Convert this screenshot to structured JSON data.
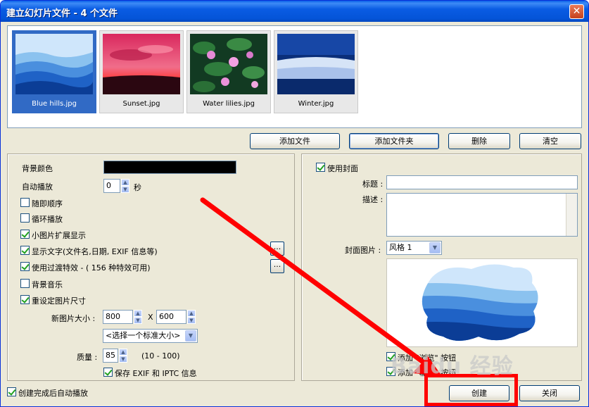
{
  "window": {
    "title": "建立幻灯片文件 - 4 个文件",
    "close_glyph": "✕"
  },
  "thumbnails": [
    {
      "caption": "Blue hills.jpg",
      "selected": true
    },
    {
      "caption": "Sunset.jpg",
      "selected": false
    },
    {
      "caption": "Water lilies.jpg",
      "selected": false
    },
    {
      "caption": "Winter.jpg",
      "selected": false
    }
  ],
  "toolbar": {
    "add_file": "添加文件",
    "add_folder": "添加文件夹",
    "delete": "删除",
    "clear": "清空"
  },
  "left": {
    "bg_color_label": "背景颜色",
    "bg_color_value": "#000000",
    "autoplay_label": "自动播放",
    "autoplay_value": "0",
    "autoplay_unit": "秒",
    "random_order": "随即顺序",
    "loop_play": "循环播放",
    "thumb_expand": "小图片扩展显示",
    "show_text": "显示文字(文件名,日期, EXIF 信息等)",
    "transition": "使用过渡特效 - ( 156 种特效可用)",
    "bg_music": "背景音乐",
    "resize": "重设定图片尺寸",
    "new_size_label": "新图片大小 :",
    "width_value": "800",
    "size_x": "X",
    "height_value": "600",
    "standard_size": "<选择一个标准大小>",
    "quality_label": "质量 :",
    "quality_value": "85",
    "quality_range": "(10 - 100)",
    "keep_exif": "保存 EXIF 和 IPTC 信息",
    "ellipsis": "..."
  },
  "right": {
    "use_cover": "使用封面",
    "title_label": "标题 :",
    "desc_label": "描述 :",
    "cover_image_label": "封面图片 :",
    "cover_style": "风格 1",
    "add_browse": "添加 \"浏览\" 按钮",
    "add_output": "添加 \"输出\" 按钮"
  },
  "footer": {
    "auto_play_after": "创建完成后自动播放",
    "create": "创建",
    "close": "关闭"
  },
  "watermark": "Baidu 经验",
  "icons": {
    "spin_up": "▲",
    "spin_down": "▼",
    "dropdown": "▼"
  },
  "colors": {
    "accent": "#316ac5",
    "annotation": "#ff0000"
  }
}
